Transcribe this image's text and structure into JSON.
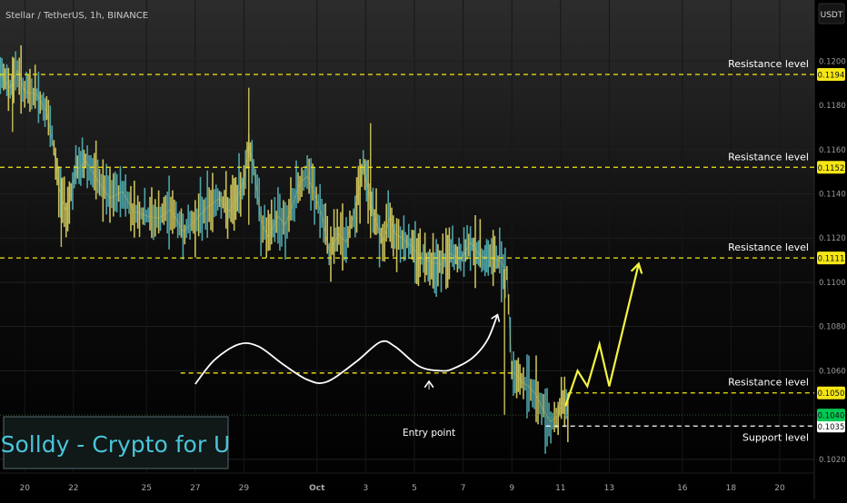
{
  "header": {
    "symbol": "Stellar / TetherUS, 1h, BINANCE",
    "currency": "USDT"
  },
  "watermark": "Solldy - Crypto for U",
  "colors": {
    "background": "#000000",
    "resistance_line": "#f5e616",
    "support_line": "#ffffff",
    "candle": "#c8c05a",
    "candle_alt": "#4fa3a8",
    "projection": "#f5f542",
    "pattern": "#ffffff",
    "last_price": "#00c853",
    "watermark": "#4ac4d9"
  },
  "chart_data": {
    "type": "line",
    "title": "Stellar / TetherUS, 1h, BINANCE",
    "ylabel": "USDT",
    "ylim": [
      0.1015,
      0.121
    ],
    "y_ticks": [
      "0.1200",
      "0.1180",
      "0.1160",
      "0.1140",
      "0.1120",
      "0.1100",
      "0.1080",
      "0.1060",
      "0.1020"
    ],
    "x_ticks": [
      "20",
      "22",
      "25",
      "27",
      "29",
      "Oct",
      "3",
      "5",
      "7",
      "9",
      "11",
      "13",
      "16",
      "18",
      "20"
    ],
    "x_tick_days": [
      -11,
      -9,
      -6,
      -4,
      -2,
      1,
      3,
      5,
      7,
      9,
      11,
      13,
      16,
      18,
      20
    ],
    "price_series": {
      "x": [
        -12.5,
        -12.0,
        -11.6,
        -11.3,
        -11.0,
        -10.5,
        -10.1,
        -9.8,
        -9.6,
        -9.3,
        -8.9,
        -8.5,
        -8.0,
        -7.5,
        -7.0,
        -6.5,
        -6.0,
        -5.5,
        -5.0,
        -4.5,
        -4.0,
        -3.5,
        -3.0,
        -2.6,
        -2.2,
        -2.0,
        -1.8,
        -1.6,
        -1.3,
        -1.0,
        -0.6,
        -0.3,
        0.0,
        0.3,
        0.6,
        0.9,
        1.2,
        1.5,
        1.9,
        2.2,
        2.5,
        2.9,
        3.3,
        3.7,
        4.0,
        4.2,
        4.5,
        4.9,
        5.3,
        5.7,
        6.1,
        6.5,
        6.9,
        7.3,
        7.7,
        8.1,
        8.5,
        8.8,
        9.0,
        9.2,
        9.4,
        9.7,
        10.0,
        10.3,
        10.6,
        10.9,
        11.1,
        11.3
      ],
      "y": [
        0.1175,
        0.1194,
        0.1188,
        0.1196,
        0.1186,
        0.1185,
        0.1177,
        0.116,
        0.1143,
        0.1132,
        0.115,
        0.1155,
        0.1146,
        0.1138,
        0.1141,
        0.1132,
        0.113,
        0.1129,
        0.1133,
        0.1123,
        0.1128,
        0.1134,
        0.1138,
        0.1132,
        0.114,
        0.1146,
        0.1163,
        0.1152,
        0.1128,
        0.112,
        0.113,
        0.1126,
        0.1135,
        0.1145,
        0.1148,
        0.114,
        0.113,
        0.1114,
        0.1122,
        0.1118,
        0.113,
        0.1152,
        0.1132,
        0.1118,
        0.113,
        0.1122,
        0.112,
        0.1116,
        0.1111,
        0.1109,
        0.1108,
        0.1113,
        0.111,
        0.1118,
        0.1112,
        0.1111,
        0.111,
        0.1105,
        0.106,
        0.1058,
        0.1055,
        0.1053,
        0.1049,
        0.1042,
        0.1037,
        0.104,
        0.1046,
        0.1044
      ]
    },
    "spikes": [
      {
        "x": -11.5,
        "low": 0.1168,
        "high": 0.1202
      },
      {
        "x": -9.5,
        "low": 0.1116,
        "high": 0.1147
      },
      {
        "x": -1.8,
        "low": 0.1126,
        "high": 0.1188
      },
      {
        "x": 3.2,
        "low": 0.112,
        "high": 0.1172
      },
      {
        "x": 8.7,
        "low": 0.104,
        "high": 0.1106
      },
      {
        "x": 10.9,
        "low": 0.1031,
        "high": 0.1046
      }
    ],
    "resistance_levels": [
      {
        "label": "Resistance level",
        "value": 0.1194,
        "tag": "0.1194"
      },
      {
        "label": "Resistance level",
        "value": 0.1152,
        "tag": "0.1152"
      },
      {
        "label": "Resistance level",
        "value": 0.1111,
        "tag": "0.1111"
      },
      {
        "label": "Resistance level",
        "value": 0.105,
        "tag": "0.1050"
      }
    ],
    "support_level": {
      "label": "Support level",
      "value": 0.1035,
      "tag": "0.1035"
    },
    "last_price": {
      "value": 0.104,
      "tag": "0.1040"
    },
    "entry_level": {
      "value": 0.1059,
      "x_start": -4.6,
      "x_end": 9.0
    },
    "annotation": {
      "text": "Entry point",
      "x": 5.6,
      "y": 0.1054
    },
    "pattern_curve": {
      "x": [
        -4.0,
        -3.2,
        -2.2,
        -1.4,
        -0.4,
        0.6,
        1.4,
        2.6,
        3.6,
        4.2,
        5.2,
        6.1,
        6.6,
        7.4,
        8.0,
        8.4
      ],
      "y": [
        0.1054,
        0.1065,
        0.1072,
        0.1071,
        0.1063,
        0.1056,
        0.1055,
        0.1064,
        0.1073,
        0.1071,
        0.1062,
        0.106,
        0.1061,
        0.1066,
        0.1074,
        0.1085
      ]
    },
    "projection": {
      "x": [
        11.2,
        11.7,
        12.1,
        12.6,
        13.0,
        14.2
      ],
      "y": [
        0.1044,
        0.106,
        0.1053,
        0.1072,
        0.1053,
        0.1108
      ]
    }
  }
}
